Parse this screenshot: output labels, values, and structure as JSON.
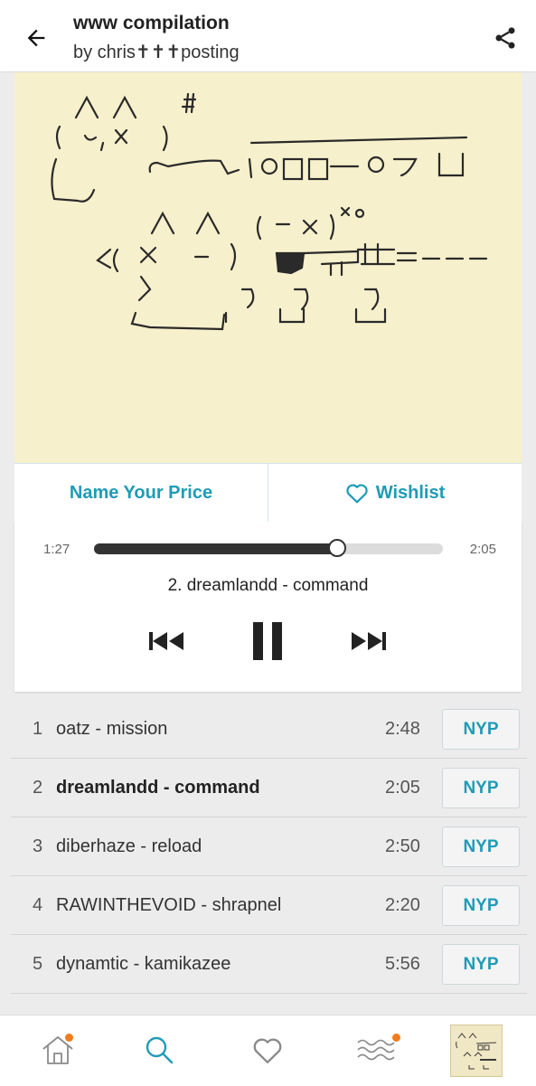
{
  "header": {
    "title": "www compilation",
    "artist": "by chris✝✝✝posting"
  },
  "actions": {
    "name_your_price": "Name Your Price",
    "wishlist": "Wishlist"
  },
  "player": {
    "elapsed": "1:27",
    "total": "2:05",
    "progress_fraction": 0.696,
    "now_playing": "2. dreamlandd - command"
  },
  "tracks": [
    {
      "num": "1",
      "title": "oatz - mission",
      "duration": "2:48",
      "price": "NYP"
    },
    {
      "num": "2",
      "title": "dreamlandd - command",
      "duration": "2:05",
      "price": "NYP"
    },
    {
      "num": "3",
      "title": "diberhaze - reload",
      "duration": "2:50",
      "price": "NYP"
    },
    {
      "num": "4",
      "title": "RAWINTHEVOID - shrapnel",
      "duration": "2:20",
      "price": "NYP"
    },
    {
      "num": "5",
      "title": "dynamtic - kamikazee",
      "duration": "5:56",
      "price": "NYP"
    }
  ],
  "colors": {
    "accent": "#1f9bb6",
    "notification": "#f07c1c",
    "art_background": "#f7f0cc"
  },
  "nav_icons": [
    "home-icon",
    "search-icon",
    "heart-icon",
    "feed-waves-icon",
    "now-playing-thumbnail"
  ]
}
